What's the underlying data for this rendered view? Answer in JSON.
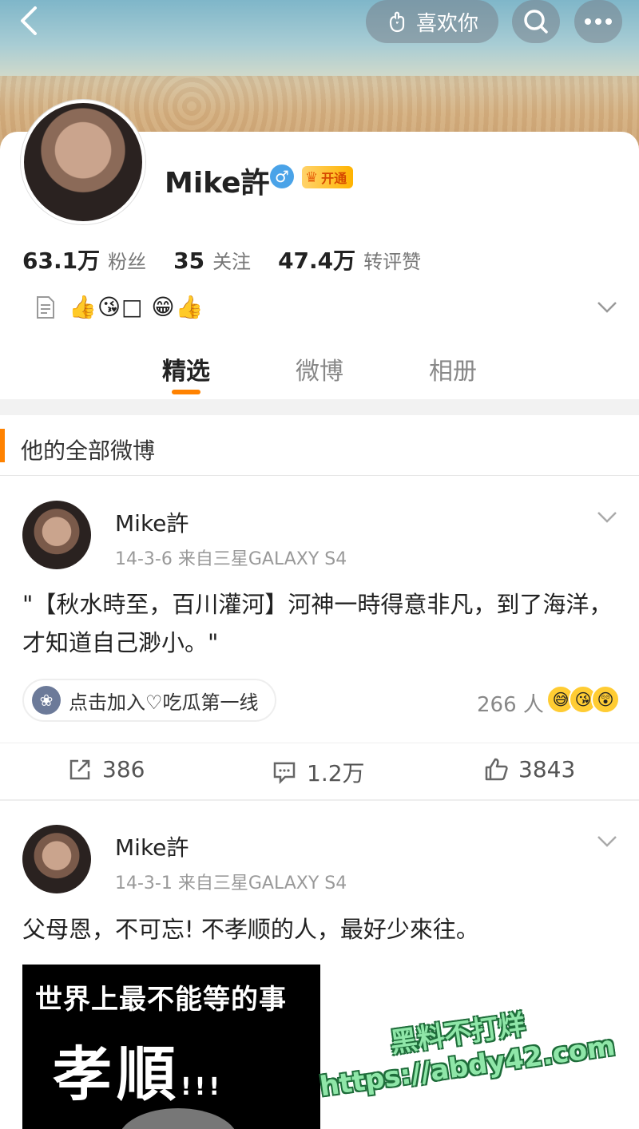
{
  "header": {
    "like_label": "喜欢你",
    "back_icon": "chevron-left-icon",
    "search_icon": "search-icon",
    "more_icon": "more-icon"
  },
  "profile": {
    "name": "Mike許",
    "gender_symbol": "♂",
    "vip_label": "开通",
    "stats": [
      {
        "num": "63.1万",
        "label": "粉丝"
      },
      {
        "num": "35",
        "label": "关注"
      },
      {
        "num": "47.4万",
        "label": "转评赞"
      }
    ],
    "bio": "👍😘□ 😁👍"
  },
  "tabs": [
    {
      "label": "精选",
      "active": true
    },
    {
      "label": "微博",
      "active": false
    },
    {
      "label": "相册",
      "active": false
    }
  ],
  "section": {
    "title": "他的全部微博"
  },
  "posts": [
    {
      "name": "Mike許",
      "meta": "14-3-6  来自三星GALAXY S4",
      "content": "\"【秋水時至，百川灌河】河神一時得意非凡，到了海洋，才知道自己渺小。\"",
      "topic": "点击加入♡吃瓜第一线",
      "topic_count": "266 人",
      "reposts": "386",
      "comments": "1.2万",
      "likes": "3843"
    },
    {
      "name": "Mike許",
      "meta": "14-3-1  来自三星GALAXY S4",
      "content": "父母恩，不可忘! 不孝顺的人，最好少來往。",
      "image_line1": "世界上最不能等的事",
      "image_line2": "孝順",
      "image_exc": "!!!"
    }
  ],
  "watermark": {
    "line1": "黑料不打烊",
    "line2": "https://abdy42.com"
  },
  "colors": {
    "accent": "#ff8200",
    "gender": "#4aa3e8",
    "watermark": "#8fe6a8"
  }
}
